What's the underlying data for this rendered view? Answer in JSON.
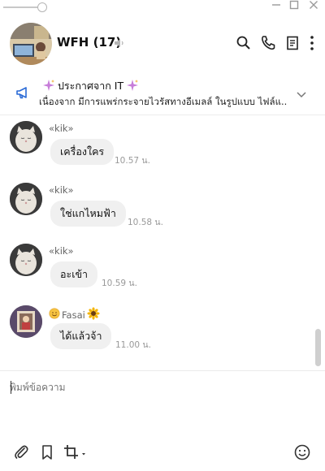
{
  "window": {
    "minimize_icon": "minimize-icon",
    "maximize_icon": "maximize-icon",
    "close_icon": "close-icon"
  },
  "header": {
    "title": "WFH",
    "member_count": "(17)",
    "icons": [
      "search-icon",
      "phone-icon",
      "notes-icon",
      "more-icon"
    ]
  },
  "announcement": {
    "title": "ประกาศจาก IT",
    "text": "เนื่องจาก มีการแพร่กระจายไวรัสทางอีเมลล์ ในรูปแบบ ไฟล์แ..."
  },
  "messages": [
    {
      "sender": "«kik»",
      "text": "เครื่องใคร",
      "time": "10.57 น."
    },
    {
      "sender": "«kik»",
      "text": "ใช่แกไหมฟ้า",
      "time": "10.58 น."
    },
    {
      "sender": "«kik»",
      "text": "อะเข้า",
      "time": "10.59 น."
    },
    {
      "sender": "Fasai",
      "text": "ได้แล้วจ้า",
      "time": "11.00 น."
    }
  ],
  "input": {
    "placeholder": "พิมพ์ข้อความ"
  },
  "toolbar": {
    "icons": [
      "attach-icon",
      "bookmark-icon",
      "crop-icon",
      "emoji-icon"
    ]
  },
  "colors": {
    "accent": "#2a6ad6",
    "bubble": "#f0f0f0",
    "sparkle": "#c77dd9"
  }
}
